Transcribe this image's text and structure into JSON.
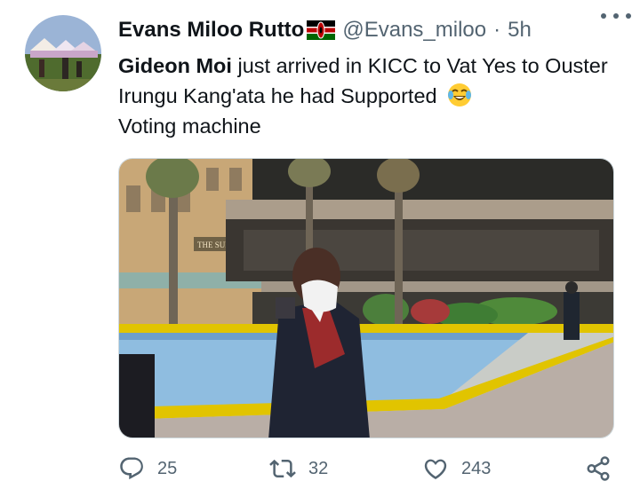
{
  "author": {
    "name": "Evans Miloo Rutto",
    "flag_icon": "kenya-flag-icon",
    "handle": "@Evans_miloo",
    "separator": "·",
    "time": "5h"
  },
  "tweet": {
    "mention_name": "Gideon Moi",
    "text_line1": " just arrived in KICC to Vat Yes to Ouster Irungu Kang'ata he had Supported",
    "text_line2": "Voting machine",
    "emoji_icon": "face-with-tears-of-joy-emoji"
  },
  "media": {
    "building_sign": "THE SUPREME COURT OF",
    "description_icon": "photo"
  },
  "actions": {
    "reply_count": "25",
    "retweet_count": "32",
    "like_count": "243"
  },
  "colors": {
    "text": "#0f1419",
    "secondary": "#536471",
    "border": "#cfd9de"
  }
}
